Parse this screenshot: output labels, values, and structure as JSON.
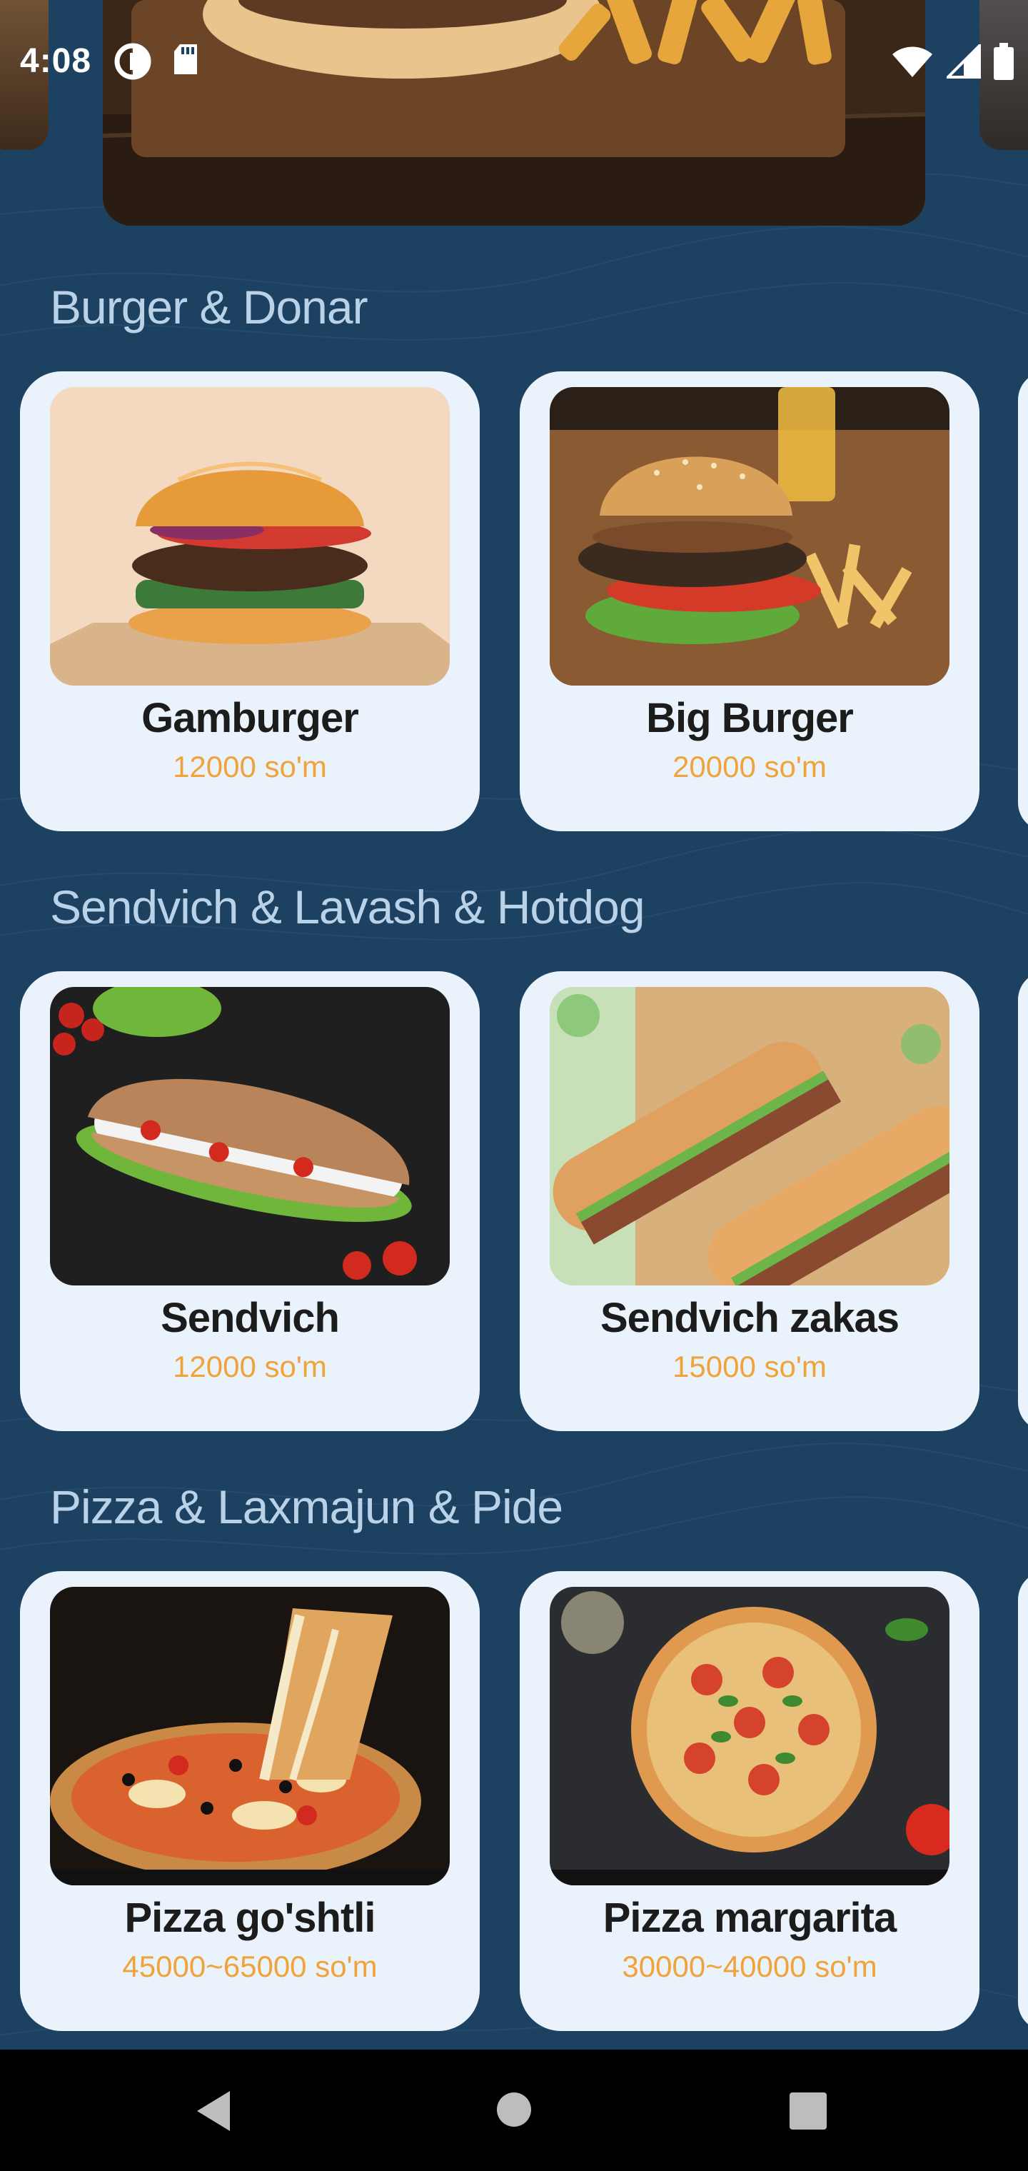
{
  "status_bar": {
    "time": "4:08",
    "left_icons": [
      "data-saver-icon",
      "sd-card-icon"
    ],
    "right_icons": [
      "wifi-icon",
      "cellular-signal-icon",
      "battery-icon"
    ]
  },
  "sections": [
    {
      "title": "Burger & Donar",
      "items": [
        {
          "name": "Gamburger",
          "price": "12000 so'm"
        },
        {
          "name": "Big Burger",
          "price": "20000 so'm"
        }
      ]
    },
    {
      "title": "Sendvich & Lavash & Hotdog",
      "items": [
        {
          "name": "Sendvich",
          "price": "12000 so'm"
        },
        {
          "name": "Sendvich zakas",
          "price": "15000 so'm"
        }
      ]
    },
    {
      "title": "Pizza & Laxmajun & Pide",
      "items": [
        {
          "name": "Pizza go'shtli",
          "price": "45000~65000 so'm"
        },
        {
          "name": "Pizza margarita",
          "price": "30000~40000 so'm"
        }
      ]
    }
  ],
  "nav_bar": {
    "icons": [
      "back-icon",
      "home-icon",
      "recents-icon"
    ]
  },
  "colors": {
    "background": "#1d4161",
    "card": "#eaf3fc",
    "price": "#f0a33a",
    "section_title": "#b9d2e8"
  }
}
